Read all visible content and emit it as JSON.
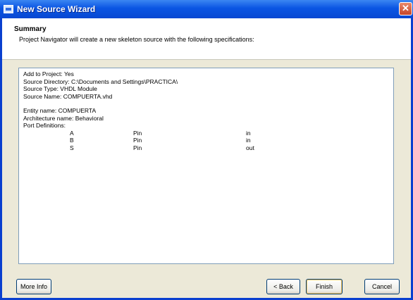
{
  "window": {
    "title": "New Source Wizard",
    "close_glyph": "✕"
  },
  "header": {
    "title": "Summary",
    "description": "Project Navigator will create a new skeleton source with the following specifications:"
  },
  "summary": {
    "lines_a": [
      "Add to Project: Yes",
      "Source Directory: C:\\Documents and Settings\\PRACTICA\\",
      "Source Type: VHDL Module",
      "Source Name: COMPUERTA.vhd"
    ],
    "lines_b": [
      "Entity name: COMPUERTA",
      "Architecture name: Behavioral",
      "Port Definitions:"
    ],
    "ports": [
      {
        "name": "A",
        "type": "Pin",
        "dir": "in"
      },
      {
        "name": "B",
        "type": "Pin",
        "dir": "in"
      },
      {
        "name": "S",
        "type": "Pin",
        "dir": "out"
      }
    ]
  },
  "buttons": {
    "more_info": "More Info",
    "back": "< Back",
    "finish": "Finish",
    "cancel": "Cancel"
  },
  "colors": {
    "titlebar": "#0a55e3",
    "dialog_bg": "#ece9d8"
  }
}
